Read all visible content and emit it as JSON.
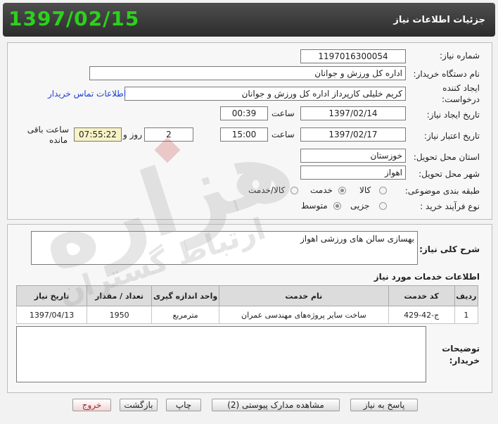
{
  "header": {
    "title": "جزئیات اطلاعات نیاز",
    "date": "1397/02/15"
  },
  "form": {
    "need_number_label": "شماره نیاز:",
    "need_number": "1197016300054",
    "buyer_org_label": "نام دستگاه خریدار:",
    "buyer_org": "اداره کل ورزش و جوانان",
    "creator_label_line1": "ایجاد کننده",
    "creator_label_line2": "درخواست:",
    "creator": "کریم خلیلی کارپرداز اداره کل ورزش و جوانان",
    "buyer_contact_link": "اطلاعات تماس خریدار",
    "created_date_label": "تاریخ ایجاد نیاز:",
    "created_date": "1397/02/14",
    "time_label": "ساعت",
    "created_time": "00:39",
    "validity_label": "تاریخ اعتبار نیاز:",
    "validity_date": "1397/02/17",
    "validity_time": "15:00",
    "days_remaining": "2",
    "days_and_label": "روز و",
    "time_remaining": "07:55:22",
    "remaining_label_line1": "ساعت باقی",
    "remaining_label_line2": "مانده",
    "province_label": "استان محل تحویل:",
    "province": "خوزستان",
    "city_label": "شهر محل تحویل:",
    "city": "اهواز",
    "category_label": "طبقه بندی موضوعی:",
    "category_options": [
      "کالا",
      "خدمت",
      "کالا/خدمت"
    ],
    "category_selected": "خدمت",
    "process_label": "نوع فرآیند خرید :",
    "process_options": [
      "جزیی",
      "متوسط"
    ],
    "process_selected": "متوسط"
  },
  "summary": {
    "label": "شرح کلی نیاز:",
    "text": "بهسازی سالن های ورزشی اهواز"
  },
  "services": {
    "section_title": "اطلاعات خدمات مورد نیاز",
    "columns": [
      "ردیف",
      "کد خدمت",
      "نام خدمت",
      "واحد اندازه گیری",
      "تعداد / مقدار",
      "تاریخ نیاز"
    ],
    "rows": [
      {
        "row": "1",
        "code": "ج-42-429",
        "name": "ساخت سایر پروژه‌های مهندسی عمران",
        "unit": "مترمربع",
        "qty": "1950",
        "date": "1397/04/13"
      }
    ]
  },
  "buyer_notes": {
    "label_line1": "توضیحات",
    "label_line2": "خریدار:",
    "text": ""
  },
  "buttons": {
    "reply": "پاسخ به نیاز",
    "attachments": "مشاهده مدارک پیوستی (2)",
    "print": "چاپ",
    "back": "بازگشت",
    "exit": "خروج"
  },
  "watermark": {
    "text_main": "هزاره",
    "text_sub": "ارتباط گستران"
  },
  "colors": {
    "header_bg": "#3a3a3a",
    "date_color": "#2bd21b",
    "link_color": "#1c3fd6"
  }
}
